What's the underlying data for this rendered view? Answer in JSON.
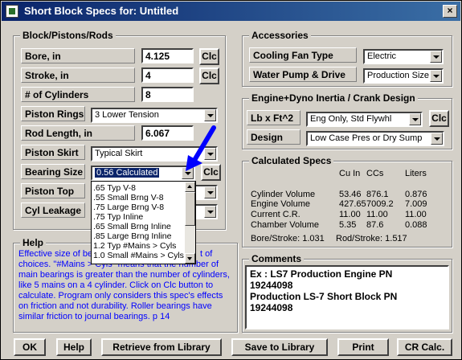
{
  "window": {
    "title": "Short Block Specs for: Untitled",
    "close_glyph": "×"
  },
  "block": {
    "title": "Block/Pistons/Rods",
    "bore_label": "Bore, in",
    "bore_value": "4.125",
    "stroke_label": "Stroke, in",
    "stroke_value": "4",
    "cylinders_label": "# of Cylinders",
    "cylinders_value": "8",
    "rings_label": "Piston Rings",
    "rings_value": "3 Lower Tension",
    "rod_label": "Rod Length, in",
    "rod_value": "6.067",
    "skirt_label": "Piston Skirt",
    "skirt_value": "Typical Skirt",
    "bearing_label": "Bearing Size",
    "bearing_value": "0.56 Calculated",
    "top_label": "Piston Top",
    "leakage_label": "Cyl Leakage",
    "clc_label": "Clc"
  },
  "bearing_dropdown": {
    "options": [
      ".65 Typ V-8",
      ".55 Small Brng V-8",
      ".75 Large Brng V-8",
      ".75 Typ Inline",
      ".65 Small Brng Inline",
      ".85 Large Brng Inline",
      "1.2 Typ #Mains > Cyls",
      "1.0 Small #Mains > Cyls"
    ]
  },
  "help": {
    "title": "Help",
    "lines": [
      "Effective size of be",
      "choices.  \"#Mains > Cyls\" means that the number of",
      "main bearings is greater than the number of cylinders,",
      "like 5 mains on a 4 cylinder.  Click on Clc button to",
      "calculate.  Program only considers this spec's effects",
      "on friction and not durability.  Roller bearings have",
      "similar friction to journal bearings.  p 14"
    ],
    "line0_tail": "t of"
  },
  "accessories": {
    "title": "Accessories",
    "fan_label": "Cooling Fan Type",
    "fan_value": "Electric",
    "pump_label": "Water Pump & Drive",
    "pump_value": "Production Size"
  },
  "inertia": {
    "title": "Engine+Dyno Inertia / Crank Design",
    "lb_label": "Lb x Ft^2",
    "lb_value": "Eng Only, Std Flywhl",
    "design_label": "Design",
    "design_value": "Low Case Pres or Dry Sump",
    "clc_label": "Clc"
  },
  "calculated": {
    "title": "Calculated Specs",
    "headers": [
      "Cu In",
      "CCs",
      "Liters"
    ],
    "rows": [
      {
        "label": "Cylinder Volume",
        "cuin": "53.46",
        "ccs": "876.1",
        "liters": "0.876"
      },
      {
        "label": "Engine Volume",
        "cuin": "427.65",
        "ccs": "7009.2",
        "liters": "7.009"
      },
      {
        "label": "Current C.R.",
        "cuin": "11.00",
        "ccs": "11.00",
        "liters": "11.00"
      },
      {
        "label": "Chamber Volume",
        "cuin": "5.35",
        "ccs": "87.6",
        "liters": "0.088"
      }
    ],
    "bore_stroke": "Bore/Stroke: 1.031",
    "rod_stroke": "Rod/Stroke: 1.517"
  },
  "comments": {
    "title": "Comments",
    "text": "Ex : LS7 Production Engine PN\n19244098\nProduction LS-7 Short Block PN\n19244098"
  },
  "buttons": {
    "ok": "OK",
    "help": "Help",
    "retrieve": "Retrieve from Library",
    "save": "Save to Library",
    "print": "Print",
    "cr_calc": "CR Calc."
  },
  "colors": {
    "help_text": "#0000ff",
    "arrow": "#0000ff",
    "titlebar": "#0a246a"
  }
}
